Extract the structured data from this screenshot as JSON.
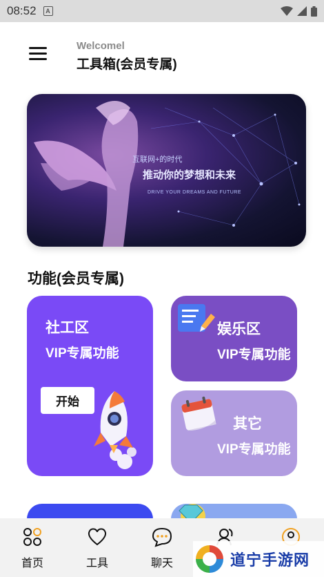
{
  "status_bar": {
    "time": "08:52",
    "notification_letter": "A"
  },
  "header": {
    "welcome": "Welcomel",
    "title": "工具箱(会员专属)"
  },
  "banner": {
    "line1": "互联网+的时代",
    "line2": "推动你的梦想和未来",
    "line3": "DRIVE YOUR DREAMS AND FUTURE"
  },
  "section": {
    "title": "功能(会员专属)"
  },
  "cards": {
    "social": {
      "title": "社工区",
      "subtitle": "VIP专属功能",
      "button": "开始"
    },
    "entertainment": {
      "title": "娱乐区",
      "subtitle": "VIP专属功能"
    },
    "other": {
      "title": "其它",
      "subtitle": "VIP专属功能"
    }
  },
  "nav": [
    {
      "label": "首页",
      "icon": "home-icon"
    },
    {
      "label": "工具",
      "icon": "heart-icon"
    },
    {
      "label": "聊天",
      "icon": "chat-icon"
    },
    {
      "label": "",
      "icon": "users-icon"
    },
    {
      "label": "",
      "icon": "profile-icon"
    }
  ],
  "watermark": {
    "text": "道宁手游网"
  },
  "colors": {
    "social_card": "#7a4af6",
    "entertainment_card": "#7a4ec4",
    "other_card": "#b19ce0",
    "blue_card": "#3c4af0"
  }
}
